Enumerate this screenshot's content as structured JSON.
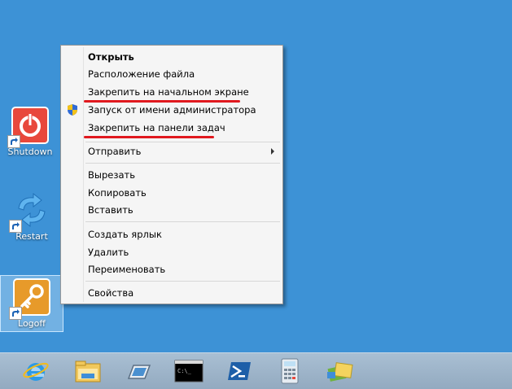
{
  "desktop": {
    "icons": [
      {
        "name": "shutdown",
        "label": "Shutdown",
        "color": "#e8483c"
      },
      {
        "name": "restart",
        "label": "Restart",
        "color": "#2f8fd8"
      },
      {
        "name": "logoff",
        "label": "Logoff",
        "color": "#e79a2a"
      }
    ]
  },
  "context_menu": {
    "items": [
      {
        "label": "Открыть",
        "bold": true
      },
      {
        "label": "Расположение файла"
      },
      {
        "label": "Закрепить на начальном экране",
        "underlined": true
      },
      {
        "label": "Запуск от имени администратора",
        "icon": "uac-shield-icon"
      },
      {
        "label": "Закрепить на панели задач",
        "underlined": true
      },
      {
        "label": "Отправить",
        "submenu": true
      },
      {
        "label": "Вырезать"
      },
      {
        "label": "Копировать"
      },
      {
        "label": "Вставить"
      },
      {
        "label": "Создать ярлык"
      },
      {
        "label": "Удалить"
      },
      {
        "label": "Переименовать"
      },
      {
        "label": "Свойства"
      }
    ],
    "underline_color": "#e0191f"
  },
  "taskbar": {
    "buttons": [
      {
        "name": "internet-explorer-icon"
      },
      {
        "name": "file-explorer-icon"
      },
      {
        "name": "server-manager-icon"
      },
      {
        "name": "command-prompt-icon",
        "text": "C:\\_"
      },
      {
        "name": "powershell-icon"
      },
      {
        "name": "calculator-icon"
      },
      {
        "name": "control-panel-icon"
      }
    ]
  }
}
